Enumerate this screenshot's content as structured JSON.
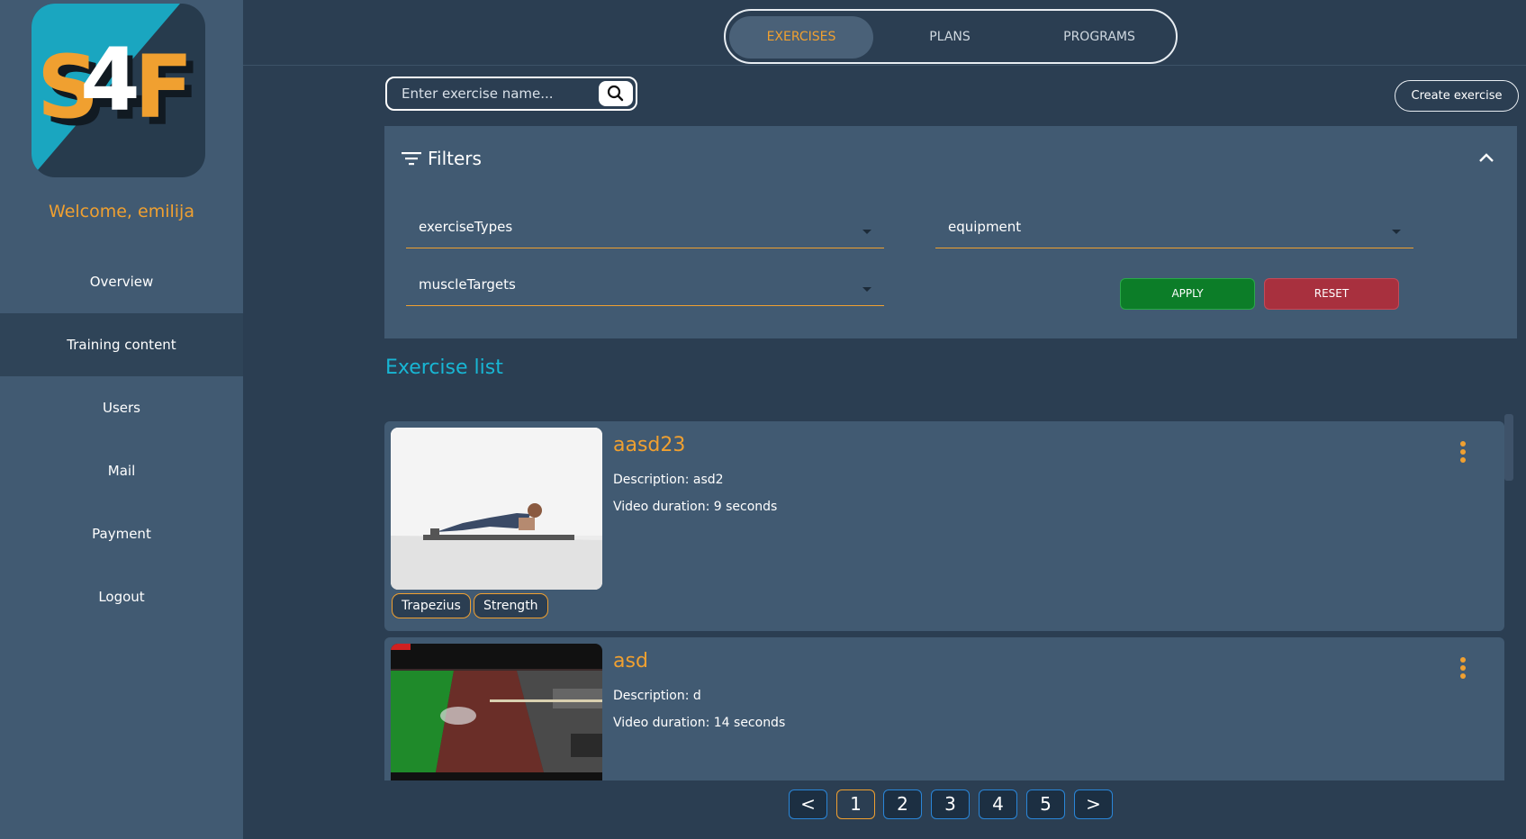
{
  "sidebar": {
    "logo_text": "S4F",
    "welcome": "Welcome, emilija",
    "items": [
      {
        "label": "Overview"
      },
      {
        "label": "Training content",
        "active": true
      },
      {
        "label": "Users"
      },
      {
        "label": "Mail"
      },
      {
        "label": "Payment"
      },
      {
        "label": "Logout"
      }
    ]
  },
  "tabs": [
    {
      "label": "EXERCISES",
      "active": true
    },
    {
      "label": "PLANS"
    },
    {
      "label": "PROGRAMS"
    }
  ],
  "search": {
    "placeholder": "Enter exercise name...",
    "icon": "search-icon"
  },
  "create_button": "Create exercise",
  "filters": {
    "title": "Filters",
    "selects": {
      "exercise_types": "exerciseTypes",
      "equipment": "equipment",
      "muscle_targets": "muscleTargets"
    },
    "apply": "APPLY",
    "reset": "RESET"
  },
  "list_title": "Exercise list",
  "exercises": [
    {
      "title": "aasd23",
      "description": "Description: asd2",
      "duration": "Video duration: 9 seconds",
      "tags": [
        "Trapezius",
        "Strength"
      ]
    },
    {
      "title": "asd",
      "description": "Description: d",
      "duration": "Video duration: 14 seconds",
      "tags": []
    }
  ],
  "pagination": {
    "prev": "<",
    "pages": [
      "1",
      "2",
      "3",
      "4",
      "5"
    ],
    "current": "1",
    "next": ">"
  },
  "colors": {
    "accent": "#f0a030",
    "heading": "#18b6d4",
    "sidebar_bg": "#415a72",
    "page_bg": "#2b3e52",
    "apply": "#0c7d28",
    "reset": "#a8303e"
  }
}
